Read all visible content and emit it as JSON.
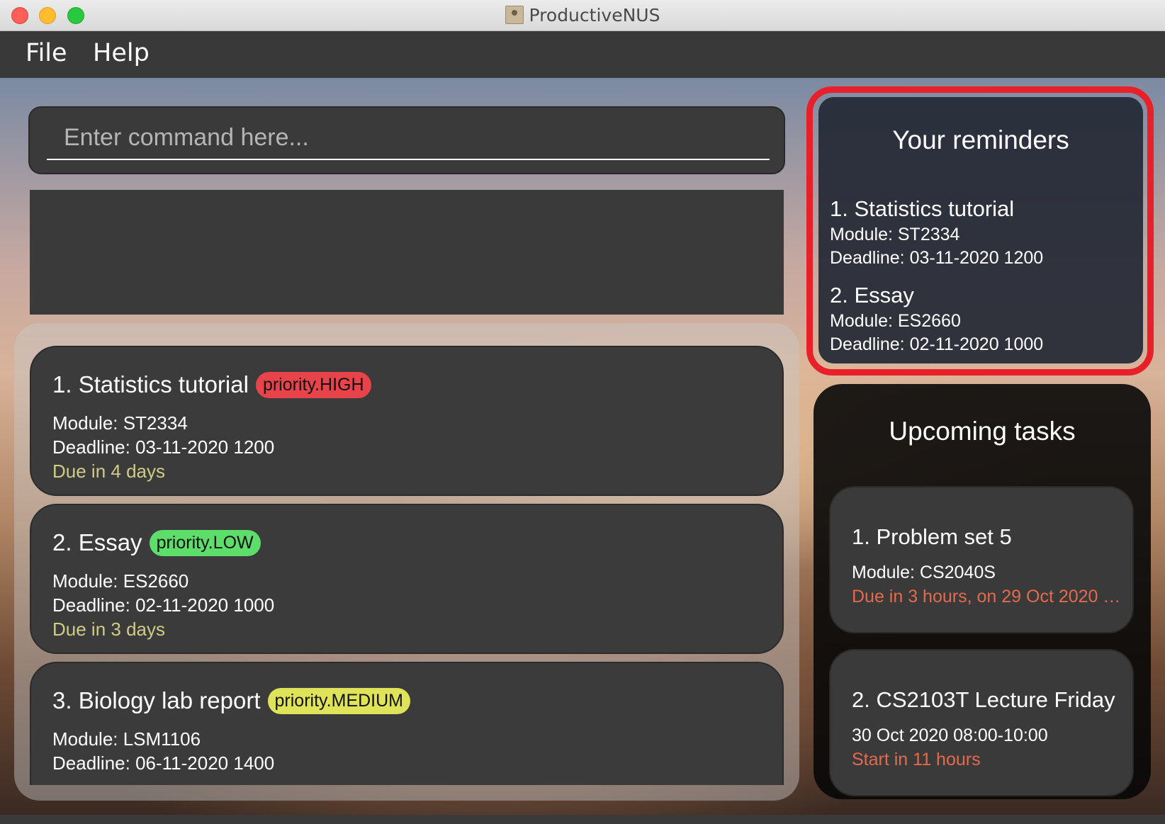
{
  "window": {
    "title": "ProductiveNUS"
  },
  "menu": {
    "file": "File",
    "help": "Help"
  },
  "command": {
    "placeholder": "Enter command here..."
  },
  "tasks": [
    {
      "title": "1.  Statistics tutorial",
      "priority": "priority.HIGH",
      "module": "Module: ST2334",
      "deadline": "Deadline: 03-11-2020 1200",
      "due": "Due in 4 days"
    },
    {
      "title": "2.  Essay",
      "priority": "priority.LOW",
      "module": "Module: ES2660",
      "deadline": "Deadline: 02-11-2020 1000",
      "due": "Due in 3 days"
    },
    {
      "title": "3.  Biology lab report",
      "priority": "priority.MEDIUM",
      "module": "Module: LSM1106",
      "deadline": "Deadline: 06-11-2020 1400",
      "due": ""
    }
  ],
  "reminders": {
    "heading": "Your reminders",
    "items": [
      {
        "title": "1.  Statistics tutorial",
        "module": "Module: ST2334",
        "deadline": "Deadline: 03-11-2020 1200"
      },
      {
        "title": "2.  Essay",
        "module": "Module: ES2660",
        "deadline": "Deadline: 02-11-2020 1000"
      }
    ]
  },
  "upcoming": {
    "heading": "Upcoming tasks",
    "items": [
      {
        "title": "1.  Problem set 5",
        "detail": "Module: CS2040S",
        "status": "Due in 3 hours, on 29 Oct 2020 2..."
      },
      {
        "title": "2.  CS2103T Lecture Friday",
        "detail": "30 Oct 2020 08:00-10:00",
        "status": "Start in 11 hours"
      }
    ]
  },
  "colors": {
    "priority_high": "#e8434a",
    "priority_low": "#5ddd6a",
    "priority_medium": "#dfe35a",
    "highlight_outline": "#e8202a",
    "due_text": "#cfcc88",
    "upcoming_status": "#e46a4e"
  }
}
